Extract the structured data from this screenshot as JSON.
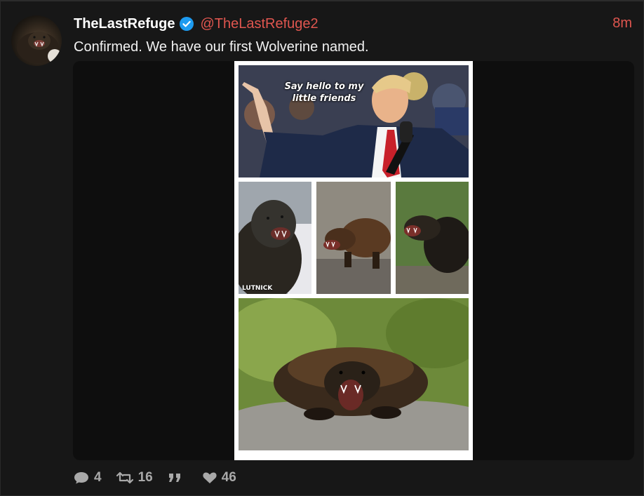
{
  "tweet": {
    "display_name": "TheLastRefuge",
    "handle": "@TheLastRefuge2",
    "timestamp": "8m",
    "text": "Confirmed.  We have our first Wolverine named.",
    "verified": true
  },
  "media": {
    "caption": "Say hello to my little friends",
    "label": "LUTNICK"
  },
  "actions": {
    "replies": "4",
    "retweets": "16",
    "quotes": "",
    "likes": "46"
  },
  "colors": {
    "accent": "#e0564f",
    "verified": "#1d9bf0",
    "background": "#171717"
  },
  "icons": [
    "verified-badge-icon",
    "reply-icon",
    "retweet-icon",
    "quote-icon",
    "heart-icon"
  ]
}
